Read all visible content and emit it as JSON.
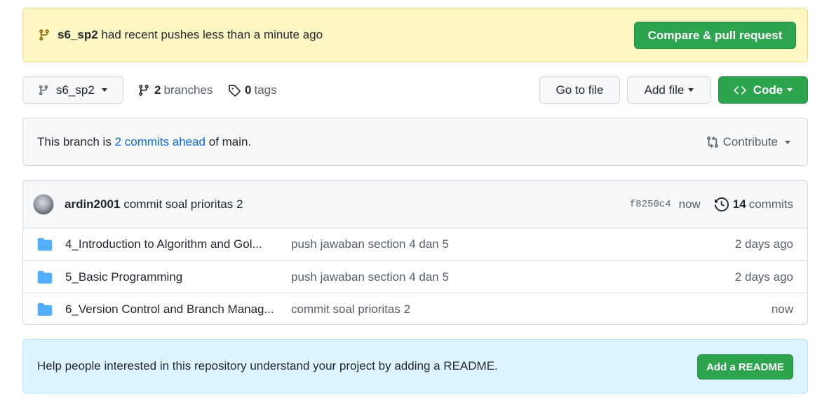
{
  "banner": {
    "branch": "s6_sp2",
    "message": "had recent pushes less than a minute ago",
    "compare_button": "Compare & pull request"
  },
  "toolbar": {
    "branch_selector": "s6_sp2",
    "branches_count": "2",
    "branches_label": "branches",
    "tags_count": "0",
    "tags_label": "tags",
    "go_to_file": "Go to file",
    "add_file": "Add file",
    "code": "Code"
  },
  "ahead": {
    "prefix": "This branch is",
    "link": "2 commits ahead",
    "suffix": "of main.",
    "contribute": "Contribute"
  },
  "latest_commit": {
    "author": "ardin2001",
    "message": "commit soal prioritas 2",
    "sha": "f8250c4",
    "time": "now",
    "commits_count": "14",
    "commits_label": "commits"
  },
  "files": [
    {
      "name": "4_Introduction to Algorithm and Gol...",
      "message": "push jawaban section 4 dan 5",
      "age": "2 days ago"
    },
    {
      "name": "5_Basic Programming",
      "message": "push jawaban section 4 dan 5",
      "age": "2 days ago"
    },
    {
      "name": "6_Version Control and Branch Manag...",
      "message": "commit soal prioritas 2",
      "age": "now"
    }
  ],
  "readme": {
    "text": "Help people interested in this repository understand your project by adding a README.",
    "button": "Add a README"
  },
  "colors": {
    "green": "#2da44e",
    "link": "#0969da",
    "folder": "#54aeff",
    "banner_bg": "#fff8c5",
    "readme_bg": "#ddf4ff"
  },
  "icons": [
    "git-branch-icon",
    "tag-icon",
    "code-icon",
    "git-compare-icon",
    "history-icon",
    "folder-icon"
  ]
}
